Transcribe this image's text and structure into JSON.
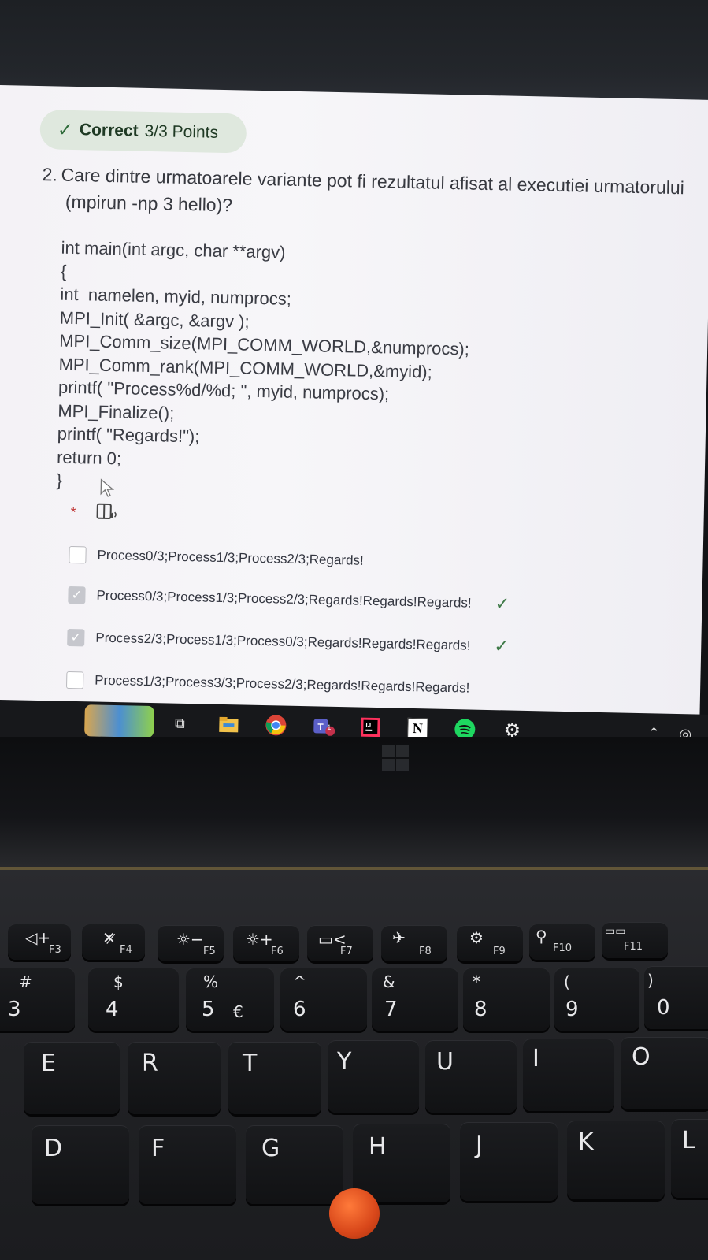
{
  "quiz": {
    "score": {
      "status": "Correct",
      "points": "3/3 Points"
    },
    "question": {
      "number": "2.",
      "text_line1": "Care dintre urmatoarele variante pot fi rezultatul afisat al executiei urmatorului",
      "text_line2": "(mpirun -np 3 hello)?"
    },
    "code": [
      "int main(int argc, char **argv)",
      "{",
      "int  namelen, myid, numprocs;",
      "MPI_Init( &argc, &argv );",
      "MPI_Comm_size(MPI_COMM_WORLD,&numprocs);",
      "MPI_Comm_rank(MPI_COMM_WORLD,&myid);",
      "printf( \"Process%d/%d; \", myid, numprocs);",
      "MPI_Finalize();",
      "printf( \"Regards!\");",
      "return 0;",
      "}"
    ],
    "required_mark": "*",
    "options": [
      {
        "label": "Process0/3;Process1/3;Process2/3;Regards!",
        "checked": false,
        "correct": false
      },
      {
        "label": "Process0/3;Process1/3;Process2/3;Regards!Regards!Regards!",
        "checked": true,
        "correct": true
      },
      {
        "label": "Process2/3;Process1/3;Process0/3;Regards!Regards!Regards!",
        "checked": true,
        "correct": true
      },
      {
        "label": "Process1/3;Process3/3;Process2/3;Regards!Regards!Regards!",
        "checked": false,
        "correct": false
      }
    ]
  },
  "taskbar": {
    "icons": [
      "widget-icon",
      "task-view-icon",
      "file-explorer-icon",
      "chrome-icon",
      "teams-icon",
      "intellij-icon",
      "notion-icon",
      "spotify-icon",
      "settings-icon"
    ],
    "teams_badge": "1",
    "notion_letter": "N"
  },
  "keyboard": {
    "fn_row": [
      {
        "label": "F3",
        "symbol": "◁+"
      },
      {
        "label": "F4",
        "symbol": "✕̷"
      },
      {
        "label": "F5",
        "symbol": "☼−"
      },
      {
        "label": "F6",
        "symbol": "☼+"
      },
      {
        "label": "F7",
        "symbol": "▭<"
      },
      {
        "label": "F8",
        "symbol": "✈"
      },
      {
        "label": "F9",
        "symbol": "⚙"
      },
      {
        "label": "F10",
        "symbol": "⚲"
      },
      {
        "label": "F11",
        "symbol": "▭▭"
      }
    ],
    "number_row": [
      {
        "top": "#",
        "main": "3"
      },
      {
        "top": "$",
        "main": "4"
      },
      {
        "top": "%",
        "main": "5",
        "extra": "€"
      },
      {
        "top": "^",
        "main": "6"
      },
      {
        "top": "&",
        "main": "7"
      },
      {
        "top": "*",
        "main": "8"
      },
      {
        "top": "(",
        "main": "9"
      },
      {
        "top": ")",
        "main": "0"
      }
    ],
    "letter_row_1": [
      "E",
      "R",
      "T",
      "Y",
      "U",
      "I",
      "O"
    ],
    "letter_row_2": [
      "D",
      "F",
      "G",
      "H",
      "J",
      "K",
      "L"
    ]
  }
}
